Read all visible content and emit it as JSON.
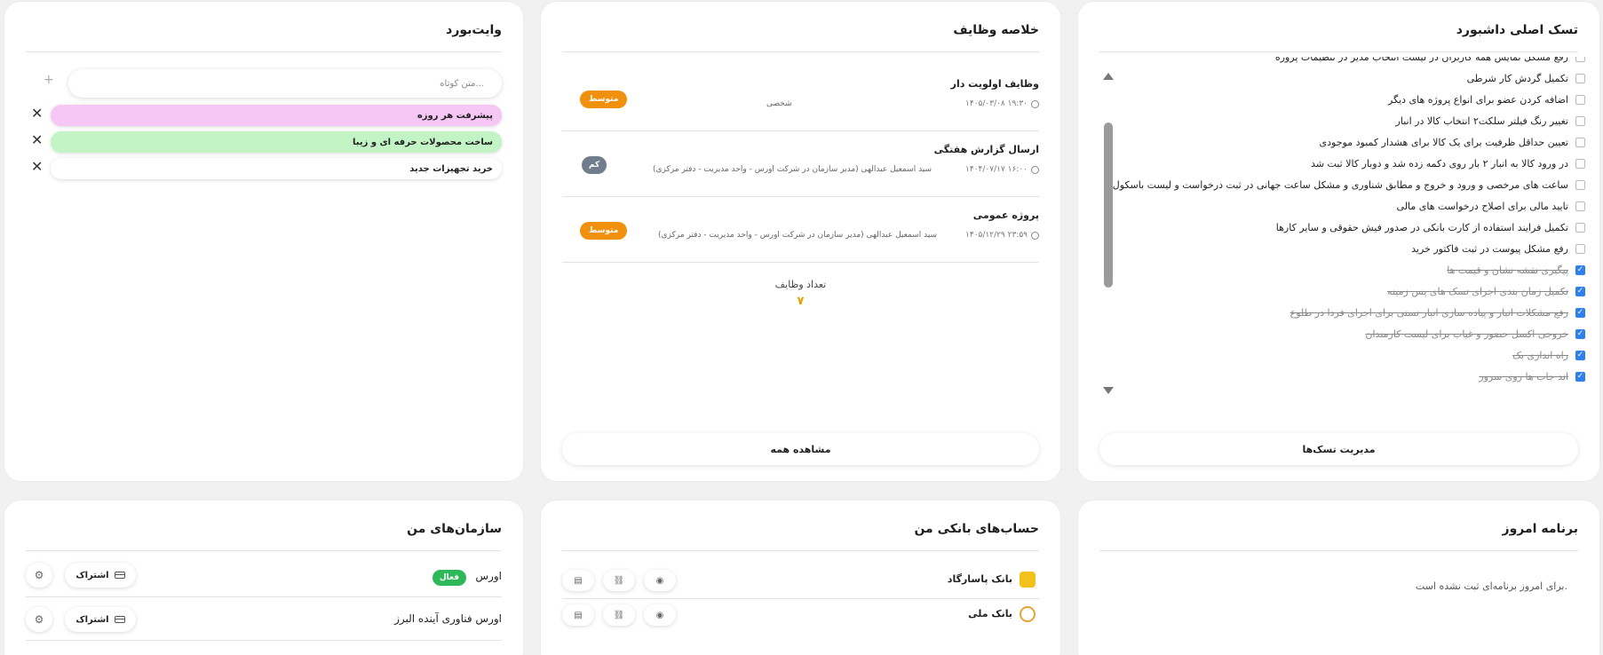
{
  "tasks_card": {
    "title": "تسک اصلی داشبورد",
    "manage_button": "مدیریت تسک‌ها",
    "items": [
      {
        "label": "رفع مشکل نمایش همه کاربران در لیست انتخاب مدیر در تنظیمات پروژه",
        "done": false
      },
      {
        "label": "تکمیل گردش کار شرطی",
        "done": false
      },
      {
        "label": "اضافه کردن عضو برای انواع پروژه های دیگر",
        "done": false
      },
      {
        "label": "تغییر رنگ فیلتر سلکت۲ انتخاب کالا در انبار",
        "done": false
      },
      {
        "label": "تعیین حداقل ظرفیت برای یک کالا برای هشدار کمبود موجودی",
        "done": false
      },
      {
        "label": "در ورود کالا به انبار ۲ بار روی دکمه زده شد و دوبار کالا ثبت شد",
        "done": false
      },
      {
        "label": "ساعت های مرخصی و ورود و خروج و مطابق شناوری و مشکل ساعت جهانی در ثبت درخواست و لیست باسکول",
        "done": false
      },
      {
        "label": "تایید مالی برای اصلاح درخواست های مالی",
        "done": false
      },
      {
        "label": "تکمیل فرایند استفاده از کارت بانکی در صدور فیش حقوقی و سایر کارها",
        "done": false
      },
      {
        "label": "رفع مشکل پیوست در ثبت فاکتور خرید",
        "done": false
      },
      {
        "label": "پیگیری نقشه نشان و قیمت ها",
        "done": true
      },
      {
        "label": "تکمیل زمان بندی اجرای تسک های پس زمینه",
        "done": true
      },
      {
        "label": "رفع مشکلات انبار و پیاده سازی انبار تستی برای اجرای فردا در طلوع",
        "done": true
      },
      {
        "label": "خروجی اکسل حضور و غیاب برای لیست کارمندان",
        "done": true
      },
      {
        "label": "راه اندازی بک",
        "done": true
      },
      {
        "label": "اند جاب ها روی سرور",
        "done": true
      }
    ]
  },
  "duties_card": {
    "title": "خلاصه وظایف",
    "view_all": "مشاهده همه",
    "count_label": "تعداد وظایف",
    "count_value": "۷",
    "items": [
      {
        "title": "وظایف اولویت دار",
        "time": "۱۴۰۵/۰۳/۰۸ ۱۹:۳۰",
        "desc": "شخصی",
        "badge": "متوسط",
        "badge_color": "#f0900c"
      },
      {
        "title": "ارسال گزارش هفتگی",
        "time": "۱۴۰۴/۰۷/۱۷ ۱۶:۰۰",
        "desc": "سید اسمعیل عبدالهی (مدیر سازمان در شرکت اورس - واحد مدیریت - دفتر مرکزی)",
        "badge": "کم",
        "badge_color": "#6f7d8c"
      },
      {
        "title": "پروژه عمومی",
        "time": "۱۴۰۵/۱۲/۲۹ ۲۳:۵۹",
        "desc": "سید اسمعیل عبدالهی (مدیر سازمان در شرکت اورس - واحد مدیریت - دفتر مرکزی)",
        "badge": "متوسط",
        "badge_color": "#f0900c"
      }
    ]
  },
  "whiteboard": {
    "title": "وایت‌بورد",
    "input_placeholder": "متن کوتاه...",
    "notes": [
      {
        "text": "پیشرفت هر روزه",
        "color": "#f6c6f4"
      },
      {
        "text": "ساخت محصولات حرفه ای و زیبا",
        "color": "#c3f4c5"
      },
      {
        "text": "خرید تجهیزات جدید",
        "color": "#ffffff"
      }
    ]
  },
  "today_card": {
    "title": "برنامه امروز",
    "empty": "برای امروز برنامه‌ای ثبت نشده است."
  },
  "banks_card": {
    "title": "حساب‌های بانکی من",
    "items": [
      {
        "name": "بانک پاسارگاد",
        "logo_color": "#f2c21b"
      },
      {
        "name": "بانک ملی",
        "logo_color": "#e8a23a"
      }
    ]
  },
  "orgs_card": {
    "title": "سازمان‌های من",
    "subscription_label": "اشتراک",
    "active_label": "فعال",
    "items": [
      {
        "name": "اورس",
        "active": true
      },
      {
        "name": "اورس فناوری آینده البرز",
        "active": false
      }
    ]
  }
}
